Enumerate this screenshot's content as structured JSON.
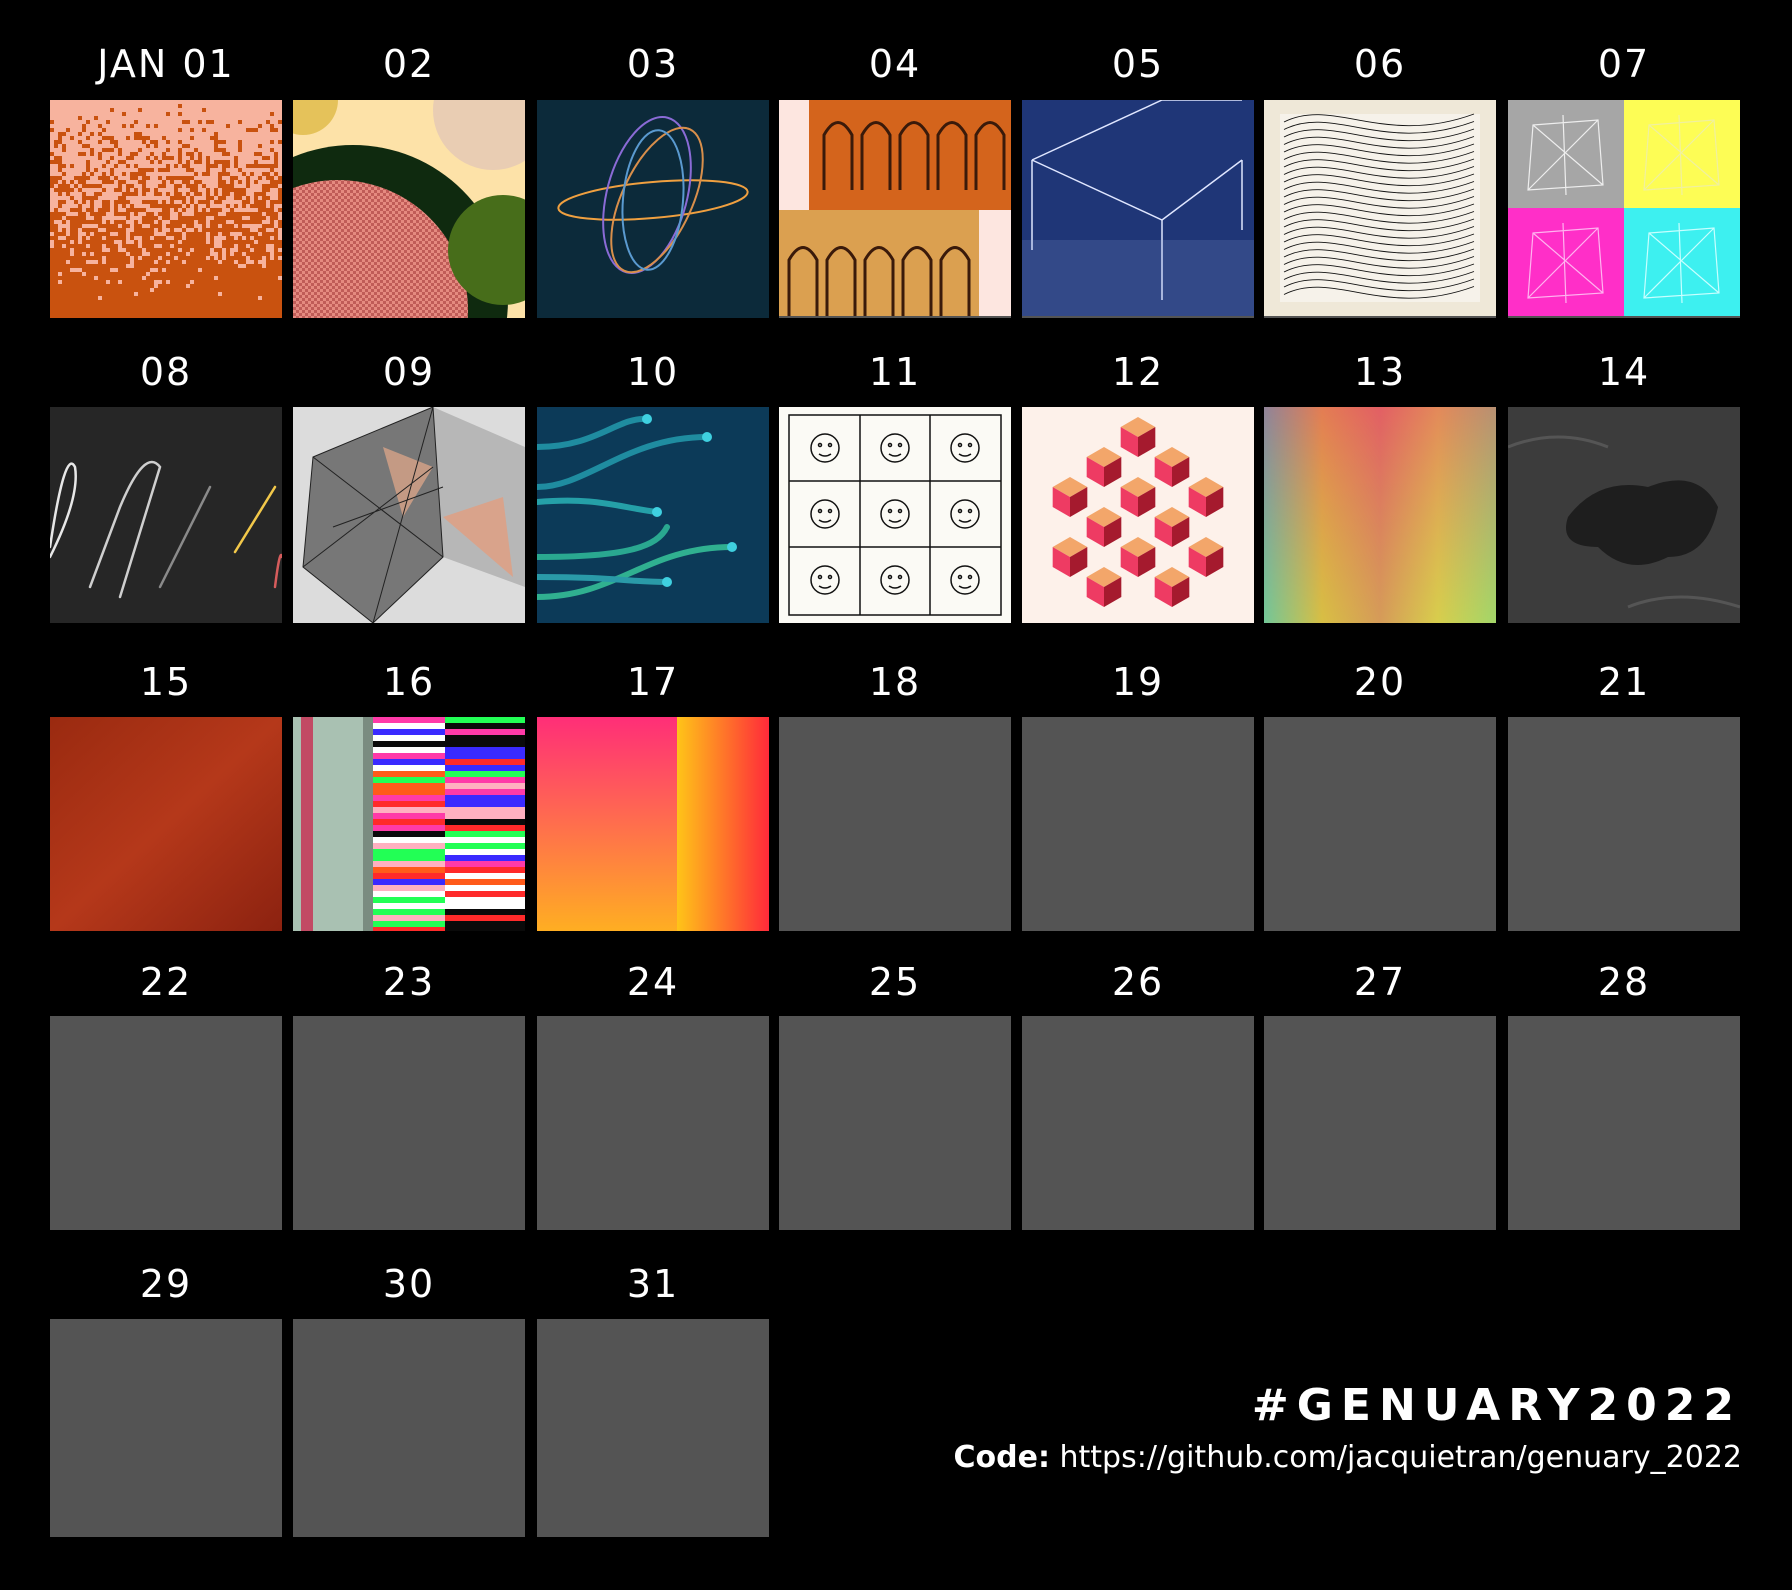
{
  "days": [
    {
      "label": "JAN 01",
      "art": "noise-orange"
    },
    {
      "label": "02",
      "art": "circles-checker"
    },
    {
      "label": "03",
      "art": "orbit-lines"
    },
    {
      "label": "04",
      "art": "arches"
    },
    {
      "label": "05",
      "art": "cube-lines"
    },
    {
      "label": "06",
      "art": "flow-field"
    },
    {
      "label": "07",
      "art": "four-quadrant-mesh"
    },
    {
      "label": "08",
      "art": "scribble-lines"
    },
    {
      "label": "09",
      "art": "triangle-mesh"
    },
    {
      "label": "10",
      "art": "glowing-curves"
    },
    {
      "label": "11",
      "art": "face-grid"
    },
    {
      "label": "12",
      "art": "isometric-cubes"
    },
    {
      "label": "13",
      "art": "blurred-gradient"
    },
    {
      "label": "14",
      "art": "terrain-map"
    },
    {
      "label": "15",
      "art": "rust-texture"
    },
    {
      "label": "16",
      "art": "glitch-bars"
    },
    {
      "label": "17",
      "art": "pink-orange-gradient"
    },
    {
      "label": "18",
      "art": "empty"
    },
    {
      "label": "19",
      "art": "empty"
    },
    {
      "label": "20",
      "art": "empty"
    },
    {
      "label": "21",
      "art": "empty"
    },
    {
      "label": "22",
      "art": "empty"
    },
    {
      "label": "23",
      "art": "empty"
    },
    {
      "label": "24",
      "art": "empty"
    },
    {
      "label": "25",
      "art": "empty"
    },
    {
      "label": "26",
      "art": "empty"
    },
    {
      "label": "27",
      "art": "empty"
    },
    {
      "label": "28",
      "art": "empty"
    },
    {
      "label": "29",
      "art": "empty"
    },
    {
      "label": "30",
      "art": "empty"
    },
    {
      "label": "31",
      "art": "empty"
    }
  ],
  "footer": {
    "title": "#GENUARY2022",
    "code_label": "Code:",
    "code_url": "https://github.com/jacquietran/genuary_2022"
  },
  "colors": {
    "background": "#000000",
    "placeholder": "#545454",
    "text": "#ffffff"
  }
}
